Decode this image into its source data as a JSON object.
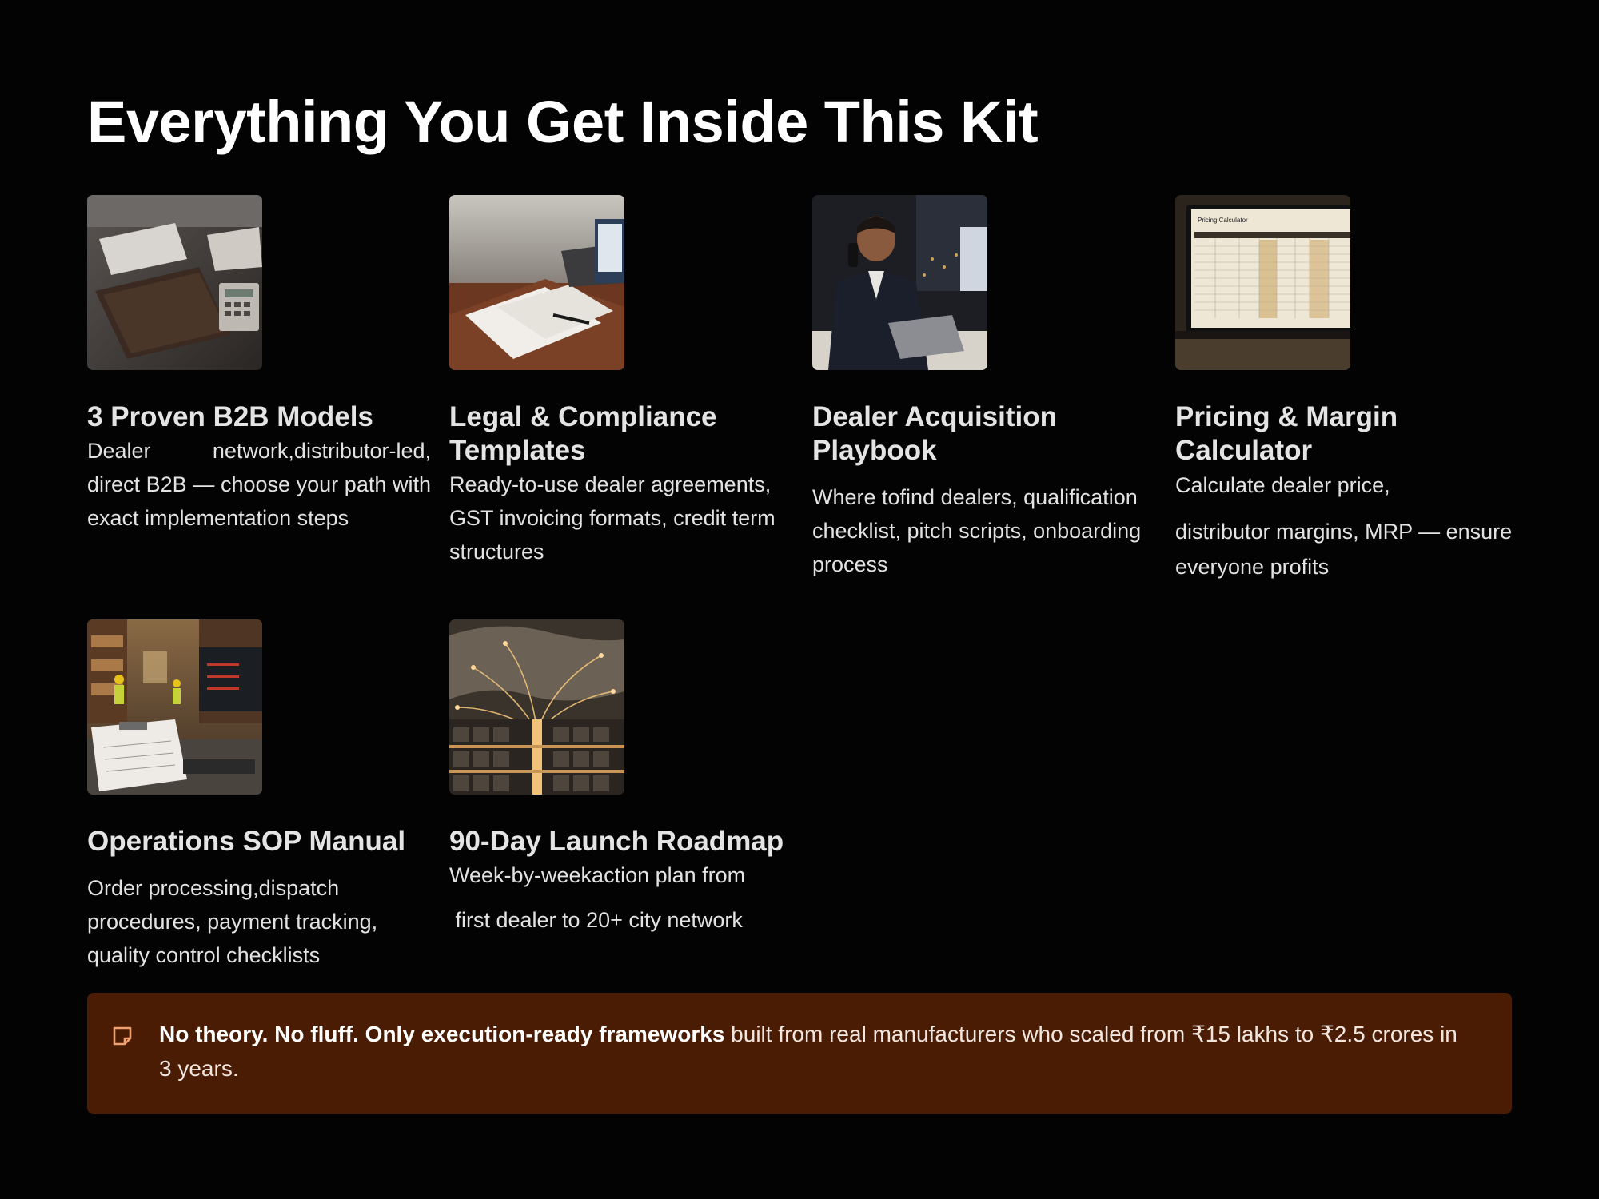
{
  "page": {
    "title": "Everything You Get Inside This Kit"
  },
  "cards": [
    {
      "title": "3 Proven B2B Models",
      "description": "Dealer network,distributor-led, direct B2B — choose your path with exact implementation steps",
      "image": "leather-planner-and-calculator-photo"
    },
    {
      "title": "Legal & Compliance Templates",
      "description": "Ready-to-use dealer agreements, GST invoicing formats, credit term structures",
      "image": "contract-documents-and-laptop-photo"
    },
    {
      "title": "Dealer Acquisition Playbook",
      "description": "Where tofind dealers, qualification checklist, pitch scripts, onboarding process",
      "image": "businessman-on-phone-photo"
    },
    {
      "title": "Pricing & Margin Calculator",
      "description_line1": "Calculate dealer price,",
      "description_line2": "distributor margins, MRP — ensure everyone profits",
      "image": "pricing-calculator-laptop-photo",
      "screen_label": "Pricing Calculator"
    },
    {
      "title": "Operations SOP Manual",
      "description": "Order processing,dispatch procedures, payment tracking, quality control checklists",
      "image": "warehouse-operations-checklist-photo"
    },
    {
      "title": "90-Day Launch Roadmap",
      "description_line1": "Week-by-weekaction plan from",
      "description_line2": " first dealer to 20+ city network",
      "image": "city-network-map-photo"
    }
  ],
  "banner": {
    "icon": "sticky-note-icon",
    "bold": "No theory. No fluff. Only execution-ready frameworks",
    "rest": " built from real manufacturers who scaled from ₹15 lakhs to ₹2.5 crores in 3 years."
  },
  "colors": {
    "background": "#030303",
    "banner_background": "#4a1c04",
    "icon_accent": "#f0a070"
  }
}
